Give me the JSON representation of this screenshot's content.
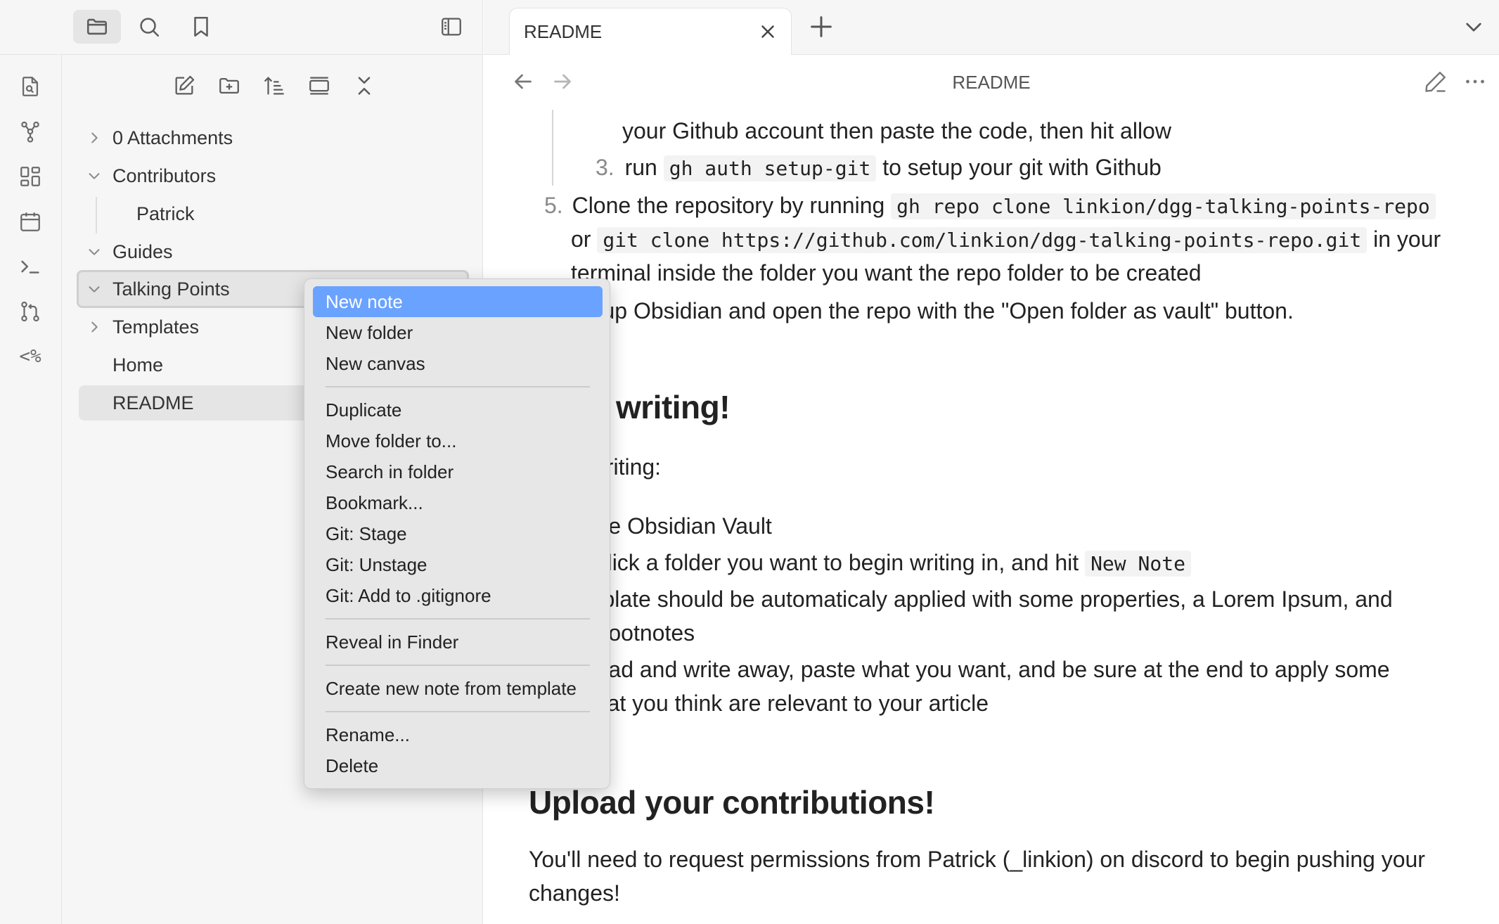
{
  "sidebar_top": {
    "buttons": [
      {
        "name": "files-view-button",
        "icon": "folder-icon",
        "active": true
      },
      {
        "name": "search-view-button",
        "icon": "search-icon",
        "active": false
      },
      {
        "name": "bookmarks-view-button",
        "icon": "bookmark-icon",
        "active": false
      }
    ],
    "collapse_icon": "sidebar-toggle-icon"
  },
  "ribbon": {
    "items": [
      {
        "name": "open-quick-switcher",
        "icon": "file-search-icon"
      },
      {
        "name": "open-graph-view",
        "icon": "graph-icon"
      },
      {
        "name": "open-canvas",
        "icon": "layout-dashboard-icon"
      },
      {
        "name": "open-daily-note",
        "icon": "calendar-icon"
      },
      {
        "name": "open-command-palette",
        "icon": "terminal-icon"
      },
      {
        "name": "open-git-source-control",
        "icon": "git-pull-request-icon"
      },
      {
        "name": "templater",
        "label": "<%",
        "icon": "templater-icon"
      }
    ]
  },
  "explorer": {
    "nav": [
      "new-note-icon",
      "new-folder-icon",
      "sort-icon",
      "collapse-all-icon",
      "expand-all-icon"
    ],
    "items": [
      {
        "label": "0 Attachments",
        "chevron": "right"
      },
      {
        "label": "Contributors",
        "chevron": "down"
      },
      {
        "label": "Patrick",
        "chevron": "none",
        "indent": true
      },
      {
        "label": "Guides",
        "chevron": "down"
      },
      {
        "label": "Talking Points",
        "chevron": "down",
        "state": "focused"
      },
      {
        "label": "Templates",
        "chevron": "right"
      },
      {
        "label": "Home",
        "chevron": "none"
      },
      {
        "label": "README",
        "chevron": "none",
        "state": "selected"
      }
    ]
  },
  "tabs": {
    "active": {
      "title": "README"
    },
    "new_tab_icon": "plus-icon",
    "list_icon": "chevron-down-icon"
  },
  "view": {
    "title": "README",
    "back_icon": "arrow-left-icon",
    "forward_icon": "arrow-right-icon",
    "edit_icon": "pencil-icon",
    "more_icon": "more-horizontal-icon"
  },
  "content": {
    "l1": "your Github account then paste the code, then hit allow",
    "l2_num": "3.",
    "l2_a": "run",
    "l2_code": "gh auth setup-git",
    "l2_b": "to setup your git with Github",
    "l3_num": "5.",
    "l3_a": "Clone the repository by running",
    "l3_code": "gh repo clone linkion/dgg-talking-points-repo",
    "l4_a": "or",
    "l4_code": "git clone https://github.com/linkion/dgg-talking-points-repo.git",
    "l4_b": "in your",
    "l5": "terminal inside the folder you want the repo folder to be created",
    "l6": "en up Obsidian and open the repo with the \"Open folder as vault\" button.",
    "h_writing": "writing!",
    "p_writing": "n writing:",
    "w1": "n the Obsidian Vault",
    "w2_a": "nt click a folder you want to begin writing in, and hit",
    "w2_code": "New Note",
    "w3": "emplate should be automaticaly applied with some properties, a Lorem Ipsum, and",
    "w4": "ne footnotes",
    "w5": "ahead and write away, paste what you want, and be sure at the end to apply some",
    "w6": "s that you think are relevant to your article",
    "h_upload": "Upload your contributions!",
    "p1": "You'll need to request permissions from Patrick (_linkion) on discord to begin pushing your",
    "p2": "changes!"
  },
  "context_menu": {
    "items": [
      {
        "label": "New note",
        "highlighted": true
      },
      {
        "label": "New folder"
      },
      {
        "label": "New canvas"
      },
      {
        "separator": true
      },
      {
        "label": "Duplicate"
      },
      {
        "label": "Move folder to..."
      },
      {
        "label": "Search in folder"
      },
      {
        "label": "Bookmark..."
      },
      {
        "label": "Git: Stage"
      },
      {
        "label": "Git: Unstage"
      },
      {
        "label": "Git: Add to .gitignore"
      },
      {
        "separator": true
      },
      {
        "label": "Reveal in Finder"
      },
      {
        "separator": true
      },
      {
        "label": "Create new note from template"
      },
      {
        "separator": true
      },
      {
        "label": "Rename..."
      },
      {
        "label": "Delete"
      }
    ]
  },
  "colors": {
    "accent": "#6aa2ff",
    "sidebar_bg": "#f6f6f6",
    "menu_bg": "#e7e7e7"
  }
}
